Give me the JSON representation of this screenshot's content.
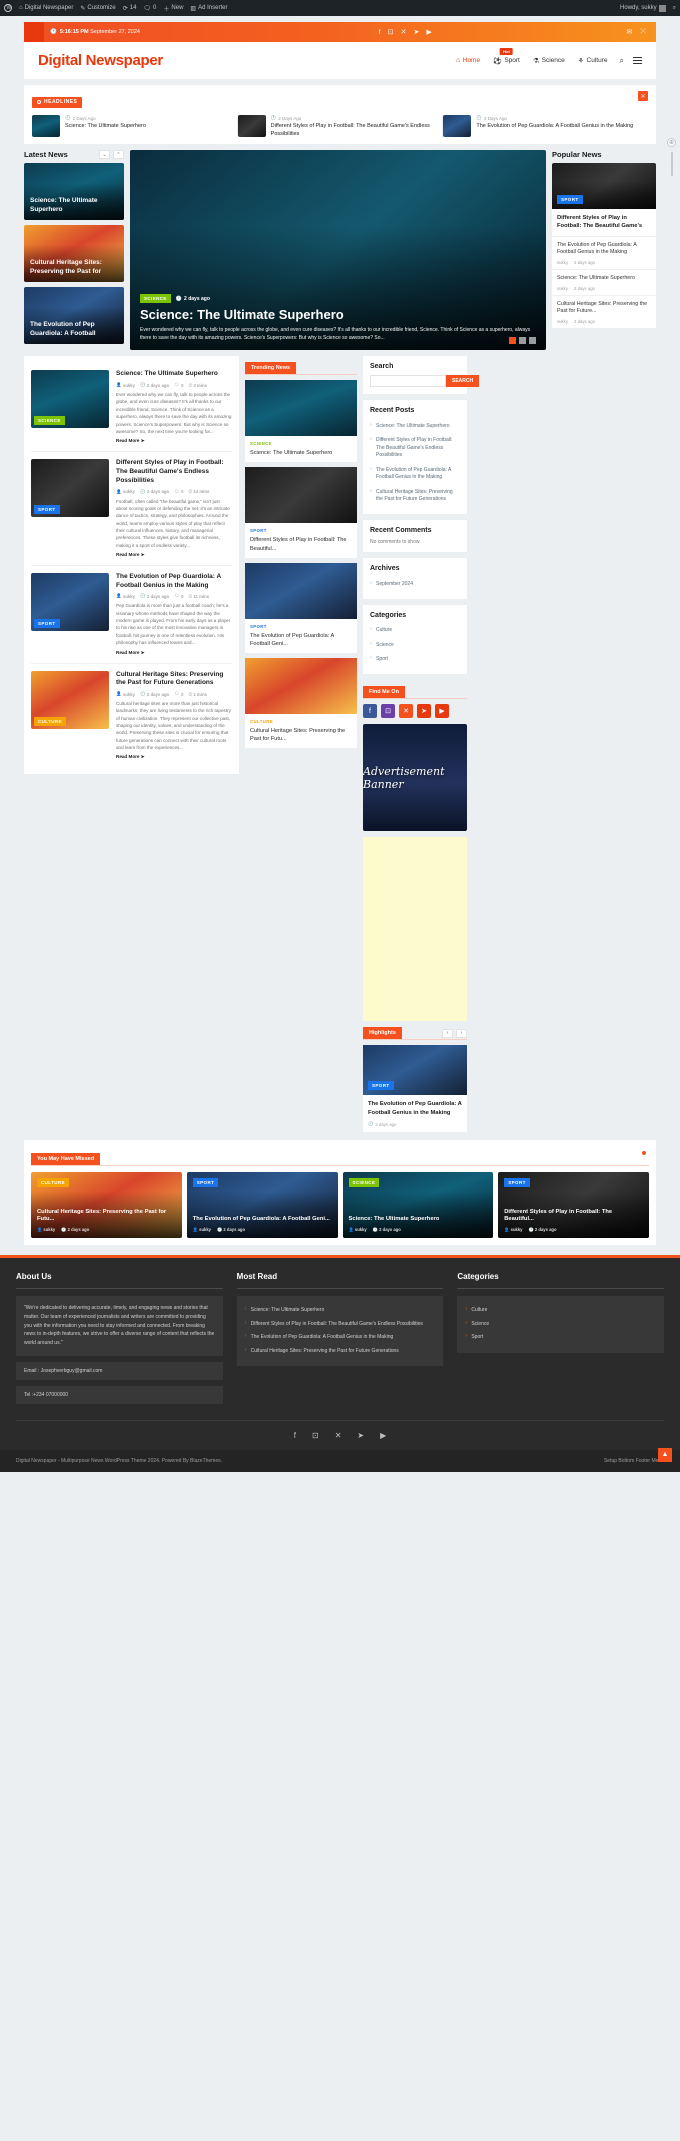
{
  "adminbar": {
    "items": [
      {
        "name": "wp-logo",
        "label": ""
      },
      {
        "name": "site-name",
        "label": "Digital Newspaper"
      },
      {
        "name": "customize",
        "label": "Customize"
      },
      {
        "name": "updates",
        "label": "14"
      },
      {
        "name": "comments",
        "label": "0"
      },
      {
        "name": "new",
        "label": "New"
      },
      {
        "name": "ad-inserter",
        "label": "Ad Inserter"
      }
    ],
    "howdy": "Howdy, sukky"
  },
  "topbar": {
    "time": "5:16:15 PM",
    "date": "September 27, 2024",
    "socials": [
      "facebook",
      "instagram",
      "x",
      "telegram",
      "youtube"
    ],
    "right_icons": [
      "mail",
      "shuffle"
    ]
  },
  "header": {
    "brand_part1": "Digital",
    "brand_part2": "Newspaper",
    "nav": [
      {
        "label": "Home",
        "icon": "home-icon",
        "active": true,
        "badge": ""
      },
      {
        "label": "Sport",
        "icon": "ball-icon",
        "active": false,
        "badge": "Hot"
      },
      {
        "label": "Science",
        "icon": "flask-icon",
        "active": false,
        "badge": ""
      },
      {
        "label": "Culture",
        "icon": "culture-icon",
        "active": false,
        "badge": ""
      }
    ]
  },
  "ticker": {
    "tag": "HEADLINES",
    "items": [
      {
        "date": "2 Days Ago",
        "title": "Science: The Ultimate Superhero",
        "img": "img-lab"
      },
      {
        "date": "2 Days Ago",
        "title": "Different Styles of Play in Football: The Beautiful Game's Endless Possibilities",
        "img": "img-tact"
      },
      {
        "date": "2 Days Ago",
        "title": "The Evolution of Pep Guardiola: A Football Genius in the Making",
        "img": "img-pep"
      }
    ]
  },
  "latest": {
    "title": "Latest News",
    "cards": [
      {
        "title": "Science: The Ultimate Superhero",
        "img": "img-lab"
      },
      {
        "title": "Cultural Heritage Sites: Preserving the Past for",
        "img": "img-cult"
      },
      {
        "title": "The Evolution of Pep Guardiola: A Football",
        "img": "img-pep"
      }
    ]
  },
  "hero": {
    "category": "SCIENCE",
    "date": "2 days ago",
    "title": "Science: The Ultimate Superhero",
    "excerpt": "Ever wondered why we can fly, talk to people across the globe, and even cure diseases? It's all thanks to our incredible friend, Science. Think of Science as a superhero, always there to save the day with its amazing powers. Science's Superpowers: But why is Science so awesome? So...",
    "img": "img-lab2",
    "dots": 3,
    "active_dot": 0
  },
  "popular": {
    "title": "Popular News",
    "lead": {
      "category": "SPORT",
      "title": "Different Styles of Play in Football: The Beautiful Game's",
      "img": "img-tact"
    },
    "items": [
      {
        "title": "The Evolution of Pep Guardiola: A Football Genius in the Making",
        "author": "sukky",
        "date": "2 days ago"
      },
      {
        "title": "Science: The Ultimate Superhero",
        "author": "sukky",
        "date": "2 days ago"
      },
      {
        "title": "Cultural Heritage Sites: Preserving the Past for Future...",
        "author": "sukky",
        "date": "2 days ago"
      }
    ]
  },
  "posts": [
    {
      "title": "Science: The Ultimate Superhero",
      "category": "SCIENCE",
      "cat_class": "",
      "author": "sukky",
      "date": "2 days ago",
      "comments": "0",
      "readtime": "3 mins",
      "excerpt": "Ever wondered why we can fly, talk to people across the globe, and even cure diseases? It's all thanks to our incredible friend, Science. Think of Science as a superhero, always there to save the day with its amazing powers. Science's Superpowers: But why is Science so awesome? So, the next time you're looking for...",
      "readmore": "Read More",
      "img": "img-lab"
    },
    {
      "title": "Different Styles of Play in Football: The Beautiful Game's Endless Possibilities",
      "category": "SPORT",
      "cat_class": "sport",
      "author": "sukky",
      "date": "2 days ago",
      "comments": "0",
      "readtime": "14 mins",
      "excerpt": "Football, often called \"the beautiful game,\" isn't just about scoring goals or defending the net; it's an intricate dance of tactics, strategy, and philosophies. Around the world, teams employ various styles of play that reflect their cultural influences, history, and managerial preferences. These styles give football its richness, making it a sport of endless variety...",
      "readmore": "Read More",
      "img": "img-tact"
    },
    {
      "title": "The Evolution of Pep Guardiola: A Football Genius in the Making",
      "category": "SPORT",
      "cat_class": "sport",
      "author": "sukky",
      "date": "2 days ago",
      "comments": "0",
      "readtime": "11 mins",
      "excerpt": "Pep Guardiola is more than just a football coach; he's a visionary whose methods have shaped the way the modern game is played. From his early days as a player to his rise as one of the most innovative managers in football, his journey is one of relentless evolution. His philosophy has influenced teams and...",
      "readmore": "Read More",
      "img": "img-pep"
    },
    {
      "title": "Cultural Heritage Sites: Preserving the Past for Future Generations",
      "category": "CULTURE",
      "cat_class": "culture",
      "author": "sukky",
      "date": "2 days ago",
      "comments": "0",
      "readtime": "1 mins",
      "excerpt": "Cultural heritage sites are more than just historical landmarks; they are living testaments to the rich tapestry of human civilization. They represent our collective past, shaping our identity, values, and understanding of the world. Preserving these sites is crucial for ensuring that future generations can connect with their cultural roots and learn from the experiences...",
      "readmore": "Read More",
      "img": "img-cult"
    }
  ],
  "trending": {
    "tag": "Trending News",
    "cards": [
      {
        "category": "SCIENCE",
        "cat_class": "science",
        "title": "Science: The Ultimate Superhero",
        "img": "img-lab"
      },
      {
        "category": "SPORT",
        "cat_class": "sport",
        "title": "Different Styles of Play in Football: The Beautiful...",
        "img": "img-tact"
      },
      {
        "category": "SPORT",
        "cat_class": "sport",
        "title": "The Evolution of Pep Guardiola: A Football Geni...",
        "img": "img-pep"
      },
      {
        "category": "CULTURE",
        "cat_class": "culture",
        "title": "Cultural Heritage Sites: Preserving the Past for Futu...",
        "img": "img-cult"
      }
    ]
  },
  "sidebar": {
    "search": {
      "title": "Search",
      "placeholder": "",
      "value": "",
      "button": "SEARCH"
    },
    "recent_posts": {
      "title": "Recent Posts",
      "items": [
        "Science: The Ultimate Superhero",
        "Different Styles of Play in Football: The Beautiful Game's Endless Possibilities",
        "The Evolution of Pep Guardiola: A Football Genius in the Making",
        "Cultural Heritage Sites: Preserving the Past for Future Generations"
      ]
    },
    "recent_comments": {
      "title": "Recent Comments",
      "empty": "No comments to show."
    },
    "archives": {
      "title": "Archives",
      "items": [
        "September 2024"
      ]
    },
    "categories": {
      "title": "Categories",
      "items": [
        "Culture",
        "Science",
        "Sport"
      ]
    },
    "findme": {
      "title": "Find Me On",
      "networks": [
        "facebook",
        "instagram",
        "x",
        "telegram",
        "youtube"
      ]
    },
    "ad": {
      "text": "Advertisement Banner"
    },
    "highlights": {
      "tag": "Highlights",
      "card": {
        "category": "SPORT",
        "title": "The Evolution of Pep Guardiola: A Football Genius in the Making",
        "date": "2 days ago",
        "img": "img-pep"
      }
    }
  },
  "missed": {
    "tag": "You May Have Missed",
    "cards": [
      {
        "category": "CULTURE",
        "cat_class": "culture",
        "title": "Cultural Heritage Sites: Preserving the Past for Futu...",
        "author": "sukky",
        "date": "2 days ago",
        "img": "img-cult"
      },
      {
        "category": "SPORT",
        "cat_class": "sport",
        "title": "The Evolution of Pep Guardiola: A Football Geni...",
        "author": "sukky",
        "date": "2 days ago",
        "img": "img-pep"
      },
      {
        "category": "SCIENCE",
        "cat_class": "",
        "title": "Science: The Ultimate Superhero",
        "author": "sukky",
        "date": "2 days ago",
        "img": "img-lab"
      },
      {
        "category": "SPORT",
        "cat_class": "sport",
        "title": "Different Styles of Play in Football: The Beautiful...",
        "author": "sukky",
        "date": "2 days ago",
        "img": "img-tact"
      }
    ]
  },
  "footer": {
    "about": {
      "title": "About Us",
      "text": "\"We're dedicated to delivering accurate, timely, and engaging news and stories that matter. Our team of experienced journalists and writers are committed to providing you with the information you need to stay informed and connected. From breaking news to in-depth features, we strive to offer a diverse range of content that reflects the world around us.\"",
      "email": "Email : Josephverbguy@gmail.com",
      "tel": "Tel :+234 07000000"
    },
    "most_read": {
      "title": "Most Read",
      "items": [
        "Science: The Ultimate Superhero",
        "Different Styles of Play in Football: The Beautiful Game's Endless Possibilities",
        "The Evolution of Pep Guardiola: A Football Genius in the Making",
        "Cultural Heritage Sites: Preserving the Past for Future Generations"
      ]
    },
    "categories": {
      "title": "Categories",
      "items": [
        "Culture",
        "Science",
        "Sport"
      ]
    },
    "socials": [
      "facebook",
      "instagram",
      "x",
      "telegram",
      "youtube"
    ],
    "copyright": "Digital Newspaper - Multipurpose News WordPress Theme 2024. Powered By BlazeThemes.",
    "bottom_links": "Setup  Bottom  Footer  Menu"
  }
}
